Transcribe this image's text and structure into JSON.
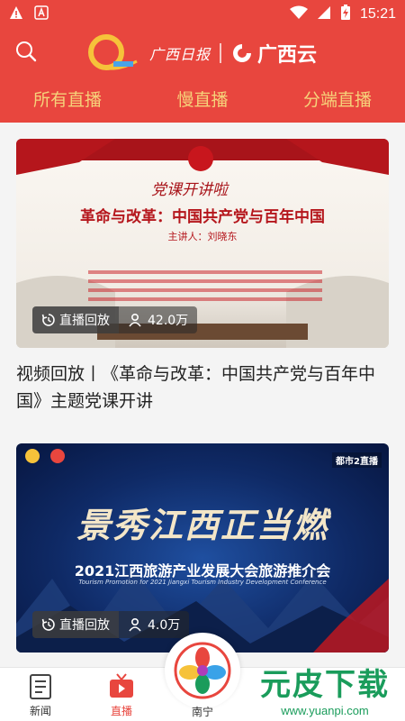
{
  "status_bar": {
    "time": "15:21",
    "icons": [
      "warning-icon",
      "app-a-icon",
      "wifi-icon",
      "signal-icon",
      "battery-charging-icon"
    ]
  },
  "header": {
    "brand_paper": "广西日报",
    "brand_cloud": "广西云",
    "search_icon": "search-icon"
  },
  "tabs": [
    {
      "label": "所有直播",
      "active": true
    },
    {
      "label": "慢直播",
      "active": false
    },
    {
      "label": "分端直播",
      "active": false
    }
  ],
  "cards": [
    {
      "badge_live": "直播回放",
      "badge_views": "42.0万",
      "title": "视频回放丨《革命与改革：中国共产党与百年中国》主题党课开讲",
      "poster": {
        "headline": "革命与改革：中国共产党与百年中国",
        "script": "党课开讲啦",
        "speaker": "主讲人：刘晓东"
      }
    },
    {
      "badge_live": "直播回放",
      "badge_views": "4.0万",
      "title": "",
      "poster": {
        "calligraphy": "景秀江西正当燃",
        "headline": "2021江西旅游产业发展大会旅游推介会",
        "english": "Tourism Promotion for 2021 Jiangxi Tourism Industry Development Conference",
        "corner": "都市2直播"
      }
    }
  ],
  "bottom_nav": [
    {
      "label": "新闻",
      "icon": "news-icon",
      "active": false
    },
    {
      "label": "直播",
      "icon": "tv-icon",
      "active": true
    },
    {
      "label": "南宁",
      "icon": "city-logo-icon",
      "active": false
    }
  ],
  "watermark": {
    "text": "元皮下载",
    "url": "www.yuanpi.com"
  },
  "colors": {
    "brand_red": "#e8463e",
    "tab_gold": "#f6d27a",
    "watermark_green": "#1a9c5b"
  }
}
